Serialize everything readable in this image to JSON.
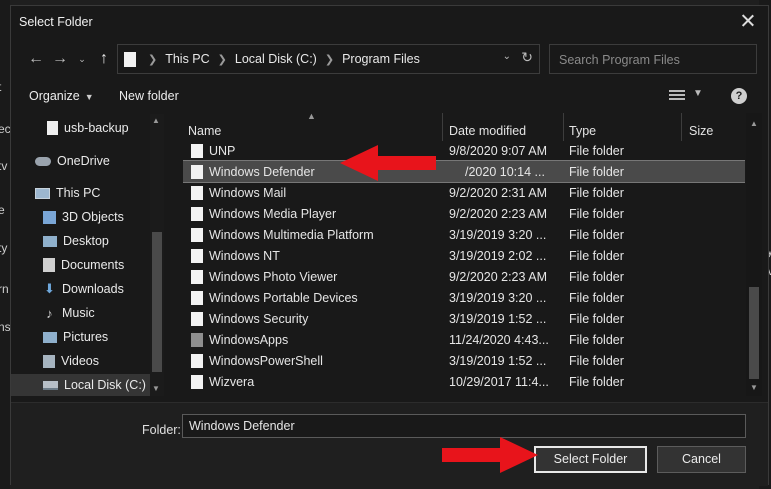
{
  "window": {
    "title": "Select Folder"
  },
  "nav": {
    "back_icon": "arrow-left-icon",
    "forward_icon": "arrow-right-icon",
    "up_icon": "arrow-up-icon",
    "breadcrumbs": [
      "This PC",
      "Local Disk (C:)",
      "Program Files"
    ],
    "search_placeholder": "Search Program Files"
  },
  "toolbar": {
    "organize_label": "Organize",
    "new_folder_label": "New folder"
  },
  "sidebar": {
    "items": [
      {
        "label": "usb-backup",
        "icon": "folder-file-icon"
      },
      {
        "label": "OneDrive",
        "icon": "cloud-icon"
      },
      {
        "label": "This PC",
        "icon": "computer-icon"
      },
      {
        "label": "3D Objects",
        "icon": "cube-icon"
      },
      {
        "label": "Desktop",
        "icon": "desktop-icon"
      },
      {
        "label": "Documents",
        "icon": "documents-icon"
      },
      {
        "label": "Downloads",
        "icon": "download-icon"
      },
      {
        "label": "Music",
        "icon": "music-icon"
      },
      {
        "label": "Pictures",
        "icon": "pictures-icon"
      },
      {
        "label": "Videos",
        "icon": "videos-icon"
      },
      {
        "label": "Local Disk (C:)",
        "icon": "disk-icon"
      }
    ]
  },
  "list": {
    "columns": [
      "Name",
      "Date modified",
      "Type",
      "Size"
    ],
    "rows": [
      {
        "name": "UNP",
        "date": "9/8/2020 9:07 AM",
        "type": "File folder"
      },
      {
        "name": "Windows Defender",
        "date": "/2020 10:14 ...",
        "type": "File folder",
        "selected": true
      },
      {
        "name": "Windows Mail",
        "date": "9/2/2020 2:31 AM",
        "type": "File folder"
      },
      {
        "name": "Windows Media Player",
        "date": "9/2/2020 2:23 AM",
        "type": "File folder"
      },
      {
        "name": "Windows Multimedia Platform",
        "date": "3/19/2019 3:20 ...",
        "type": "File folder"
      },
      {
        "name": "Windows NT",
        "date": "3/19/2019 2:02 ...",
        "type": "File folder"
      },
      {
        "name": "Windows Photo Viewer",
        "date": "9/2/2020 2:23 AM",
        "type": "File folder"
      },
      {
        "name": "Windows Portable Devices",
        "date": "3/19/2019 3:20 ...",
        "type": "File folder"
      },
      {
        "name": "Windows Security",
        "date": "3/19/2019 1:52 ...",
        "type": "File folder"
      },
      {
        "name": "WindowsApps",
        "date": "11/24/2020 4:43...",
        "type": "File folder",
        "grey": true
      },
      {
        "name": "WindowsPowerShell",
        "date": "3/19/2019 1:52 ...",
        "type": "File folder"
      },
      {
        "name": "Wizvera",
        "date": "10/29/2017 11:4...",
        "type": "File folder"
      }
    ]
  },
  "footer": {
    "folder_label": "Folder:",
    "folder_value": "Windows Defender",
    "select_label": "Select Folder",
    "cancel_label": "Cancel"
  },
  "background": {
    "left_text": [
      "t",
      "ec",
      "tv",
      "e",
      "ty",
      "rn",
      "ns"
    ],
    "right_text": [
      "tt",
      "cy",
      "ev"
    ]
  },
  "colors": {
    "annotation_red": "#e8141b",
    "selected_row": "#4a4a4a",
    "background": "#191919"
  }
}
